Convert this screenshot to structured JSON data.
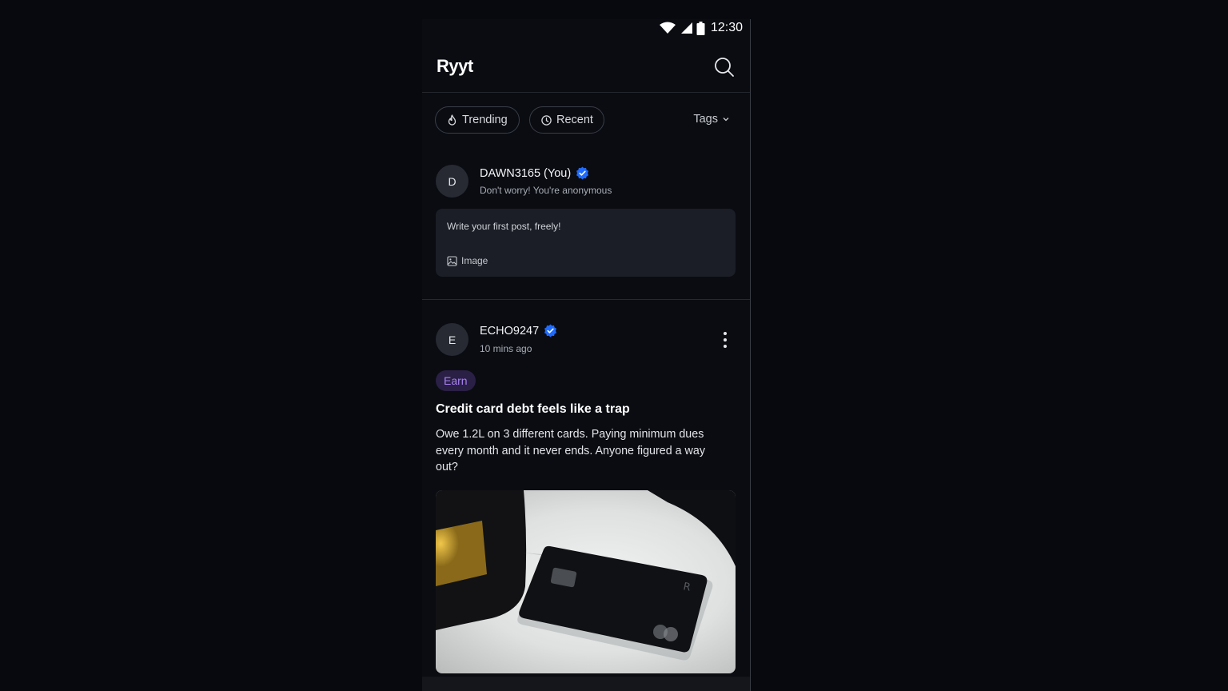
{
  "status_bar": {
    "time": "12:30"
  },
  "app": {
    "logo": "Ryyt"
  },
  "filters": {
    "trending_label": "Trending",
    "recent_label": "Recent",
    "tags_label": "Tags"
  },
  "composer": {
    "avatar_letter": "D",
    "username": "DAWN3165 (You)",
    "subtitle": "Don't worry! You're anonymous",
    "placeholder": "Write your first post, freely!",
    "image_label": "Image"
  },
  "post": {
    "avatar_letter": "E",
    "username": "ECHO9247",
    "time": "10 mins ago",
    "tag": "Earn",
    "title": "Credit card debt feels like a trap",
    "body": "Owe 1.2L on 3 different cards. Paying minimum dues every month and it never ends. Anyone figured a way out?"
  },
  "colors": {
    "verified_badge": "#1f6bff",
    "tag_bg": "#2a1f45",
    "tag_text": "#a781f2",
    "background": "#0a0c12"
  },
  "icons": [
    "wifi-icon",
    "signal-icon",
    "battery-icon",
    "search-icon",
    "flame-icon",
    "clock-icon",
    "chevron-down-icon",
    "verified-icon",
    "image-icon",
    "more-vertical-icon"
  ]
}
